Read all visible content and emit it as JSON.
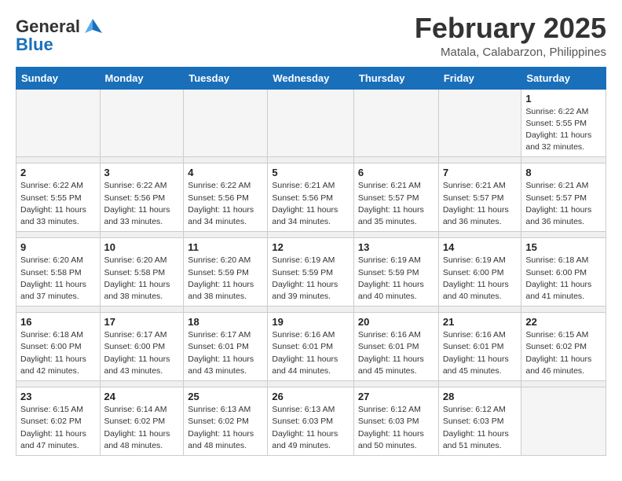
{
  "header": {
    "logo_line1": "General",
    "logo_line2": "Blue",
    "month": "February 2025",
    "location": "Matala, Calabarzon, Philippines"
  },
  "days_of_week": [
    "Sunday",
    "Monday",
    "Tuesday",
    "Wednesday",
    "Thursday",
    "Friday",
    "Saturday"
  ],
  "weeks": [
    [
      {
        "day": "",
        "info": ""
      },
      {
        "day": "",
        "info": ""
      },
      {
        "day": "",
        "info": ""
      },
      {
        "day": "",
        "info": ""
      },
      {
        "day": "",
        "info": ""
      },
      {
        "day": "",
        "info": ""
      },
      {
        "day": "1",
        "info": "Sunrise: 6:22 AM\nSunset: 5:55 PM\nDaylight: 11 hours\nand 32 minutes."
      }
    ],
    [
      {
        "day": "2",
        "info": "Sunrise: 6:22 AM\nSunset: 5:55 PM\nDaylight: 11 hours\nand 33 minutes."
      },
      {
        "day": "3",
        "info": "Sunrise: 6:22 AM\nSunset: 5:56 PM\nDaylight: 11 hours\nand 33 minutes."
      },
      {
        "day": "4",
        "info": "Sunrise: 6:22 AM\nSunset: 5:56 PM\nDaylight: 11 hours\nand 34 minutes."
      },
      {
        "day": "5",
        "info": "Sunrise: 6:21 AM\nSunset: 5:56 PM\nDaylight: 11 hours\nand 34 minutes."
      },
      {
        "day": "6",
        "info": "Sunrise: 6:21 AM\nSunset: 5:57 PM\nDaylight: 11 hours\nand 35 minutes."
      },
      {
        "day": "7",
        "info": "Sunrise: 6:21 AM\nSunset: 5:57 PM\nDaylight: 11 hours\nand 36 minutes."
      },
      {
        "day": "8",
        "info": "Sunrise: 6:21 AM\nSunset: 5:57 PM\nDaylight: 11 hours\nand 36 minutes."
      }
    ],
    [
      {
        "day": "9",
        "info": "Sunrise: 6:20 AM\nSunset: 5:58 PM\nDaylight: 11 hours\nand 37 minutes."
      },
      {
        "day": "10",
        "info": "Sunrise: 6:20 AM\nSunset: 5:58 PM\nDaylight: 11 hours\nand 38 minutes."
      },
      {
        "day": "11",
        "info": "Sunrise: 6:20 AM\nSunset: 5:59 PM\nDaylight: 11 hours\nand 38 minutes."
      },
      {
        "day": "12",
        "info": "Sunrise: 6:19 AM\nSunset: 5:59 PM\nDaylight: 11 hours\nand 39 minutes."
      },
      {
        "day": "13",
        "info": "Sunrise: 6:19 AM\nSunset: 5:59 PM\nDaylight: 11 hours\nand 40 minutes."
      },
      {
        "day": "14",
        "info": "Sunrise: 6:19 AM\nSunset: 6:00 PM\nDaylight: 11 hours\nand 40 minutes."
      },
      {
        "day": "15",
        "info": "Sunrise: 6:18 AM\nSunset: 6:00 PM\nDaylight: 11 hours\nand 41 minutes."
      }
    ],
    [
      {
        "day": "16",
        "info": "Sunrise: 6:18 AM\nSunset: 6:00 PM\nDaylight: 11 hours\nand 42 minutes."
      },
      {
        "day": "17",
        "info": "Sunrise: 6:17 AM\nSunset: 6:00 PM\nDaylight: 11 hours\nand 43 minutes."
      },
      {
        "day": "18",
        "info": "Sunrise: 6:17 AM\nSunset: 6:01 PM\nDaylight: 11 hours\nand 43 minutes."
      },
      {
        "day": "19",
        "info": "Sunrise: 6:16 AM\nSunset: 6:01 PM\nDaylight: 11 hours\nand 44 minutes."
      },
      {
        "day": "20",
        "info": "Sunrise: 6:16 AM\nSunset: 6:01 PM\nDaylight: 11 hours\nand 45 minutes."
      },
      {
        "day": "21",
        "info": "Sunrise: 6:16 AM\nSunset: 6:01 PM\nDaylight: 11 hours\nand 45 minutes."
      },
      {
        "day": "22",
        "info": "Sunrise: 6:15 AM\nSunset: 6:02 PM\nDaylight: 11 hours\nand 46 minutes."
      }
    ],
    [
      {
        "day": "23",
        "info": "Sunrise: 6:15 AM\nSunset: 6:02 PM\nDaylight: 11 hours\nand 47 minutes."
      },
      {
        "day": "24",
        "info": "Sunrise: 6:14 AM\nSunset: 6:02 PM\nDaylight: 11 hours\nand 48 minutes."
      },
      {
        "day": "25",
        "info": "Sunrise: 6:13 AM\nSunset: 6:02 PM\nDaylight: 11 hours\nand 48 minutes."
      },
      {
        "day": "26",
        "info": "Sunrise: 6:13 AM\nSunset: 6:03 PM\nDaylight: 11 hours\nand 49 minutes."
      },
      {
        "day": "27",
        "info": "Sunrise: 6:12 AM\nSunset: 6:03 PM\nDaylight: 11 hours\nand 50 minutes."
      },
      {
        "day": "28",
        "info": "Sunrise: 6:12 AM\nSunset: 6:03 PM\nDaylight: 11 hours\nand 51 minutes."
      },
      {
        "day": "",
        "info": ""
      }
    ]
  ]
}
